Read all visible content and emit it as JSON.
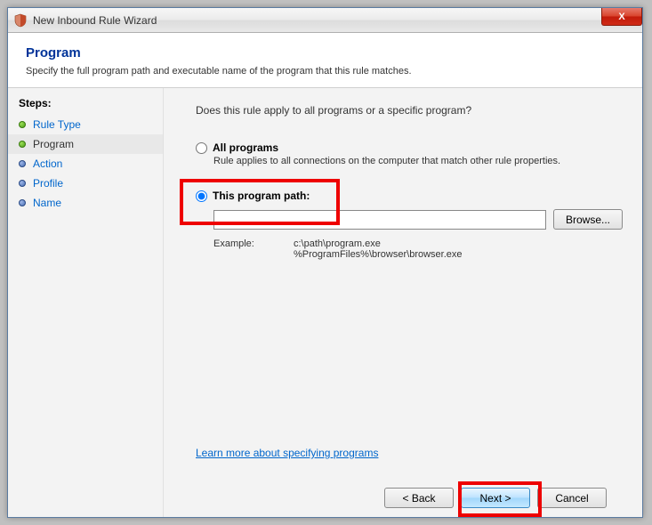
{
  "window": {
    "title": "New Inbound Rule Wizard",
    "close_label": "X"
  },
  "header": {
    "title": "Program",
    "subtitle": "Specify the full program path and executable name of the program that this rule matches."
  },
  "sidebar": {
    "title": "Steps:",
    "items": [
      {
        "label": "Rule Type",
        "state": "done"
      },
      {
        "label": "Program",
        "state": "current"
      },
      {
        "label": "Action",
        "state": "pending"
      },
      {
        "label": "Profile",
        "state": "pending"
      },
      {
        "label": "Name",
        "state": "pending"
      }
    ]
  },
  "content": {
    "question": "Does this rule apply to all programs or a specific program?",
    "all_programs": {
      "label": "All programs",
      "desc": "Rule applies to all connections on the computer that match other rule properties."
    },
    "this_program": {
      "label": "This program path:",
      "path_value": "",
      "browse_label": "Browse...",
      "example_label": "Example:",
      "example_text": "c:\\path\\program.exe\n%ProgramFiles%\\browser\\browser.exe"
    },
    "learn_link": "Learn more about specifying programs"
  },
  "footer": {
    "back": "< Back",
    "next": "Next >",
    "cancel": "Cancel"
  }
}
